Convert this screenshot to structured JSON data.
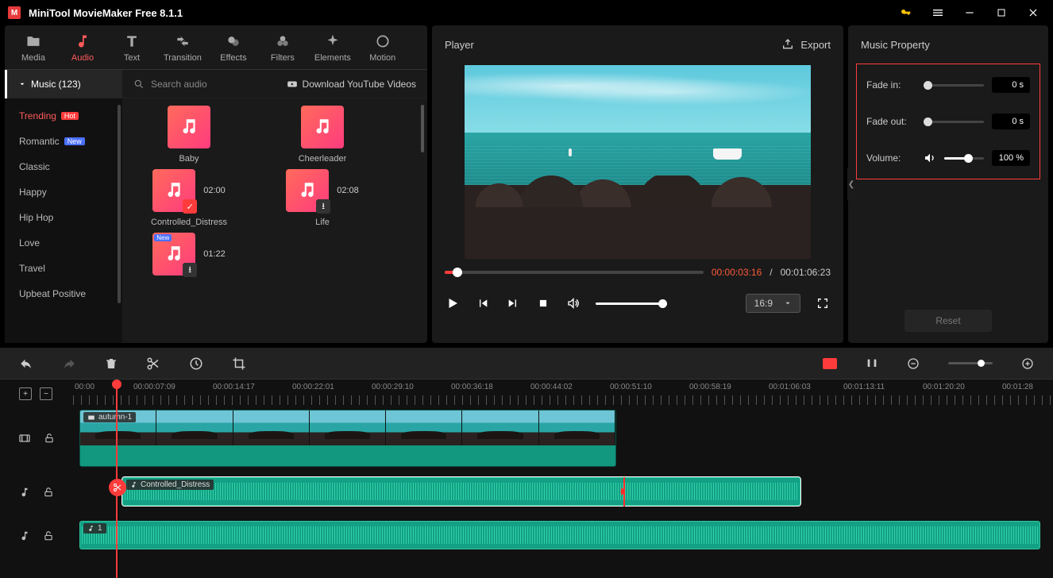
{
  "app": {
    "title": "MiniTool MovieMaker Free 8.1.1"
  },
  "tabs": [
    {
      "label": "Media"
    },
    {
      "label": "Audio"
    },
    {
      "label": "Text"
    },
    {
      "label": "Transition"
    },
    {
      "label": "Effects"
    },
    {
      "label": "Filters"
    },
    {
      "label": "Elements"
    },
    {
      "label": "Motion"
    }
  ],
  "music": {
    "header": "Music (123)",
    "search_placeholder": "Search audio",
    "download_label": "Download YouTube Videos",
    "categories": [
      {
        "label": "Trending",
        "badge": "Hot",
        "active": true
      },
      {
        "label": "Romantic",
        "badge": "New"
      },
      {
        "label": "Classic"
      },
      {
        "label": "Happy"
      },
      {
        "label": "Hip Hop"
      },
      {
        "label": "Love"
      },
      {
        "label": "Travel"
      },
      {
        "label": "Upbeat Positive"
      }
    ],
    "items": [
      {
        "label": "Baby",
        "dur": ""
      },
      {
        "label": "Cheerleader",
        "dur": ""
      },
      {
        "label": "Controlled_Distress",
        "dur": "02:00",
        "checked": true
      },
      {
        "label": "Life",
        "dur": "02:08",
        "download": true
      },
      {
        "label": "",
        "dur": "01:22",
        "download": true,
        "newtag": true
      }
    ]
  },
  "player": {
    "title": "Player",
    "export": "Export",
    "current": "00:00:03:16",
    "sep": " / ",
    "total": "00:01:06:23",
    "ratio": "16:9"
  },
  "props": {
    "title": "Music Property",
    "fadein_lbl": "Fade in:",
    "fadein_val": "0 s",
    "fadeout_lbl": "Fade out:",
    "fadeout_val": "0 s",
    "volume_lbl": "Volume:",
    "volume_val": "100 %",
    "reset": "Reset"
  },
  "ruler": [
    "00:00",
    "00:00:07:09",
    "00:00:14:17",
    "00:00:22:01",
    "00:00:29:10",
    "00:00:36:18",
    "00:00:44:02",
    "00:00:51:10",
    "00:00:58:19",
    "00:01:06:03",
    "00:01:13:11",
    "00:01:20:20",
    "00:01:28"
  ],
  "clips": {
    "video": "autumn-1",
    "audio1": "Controlled_Distress",
    "audio2": "1"
  }
}
